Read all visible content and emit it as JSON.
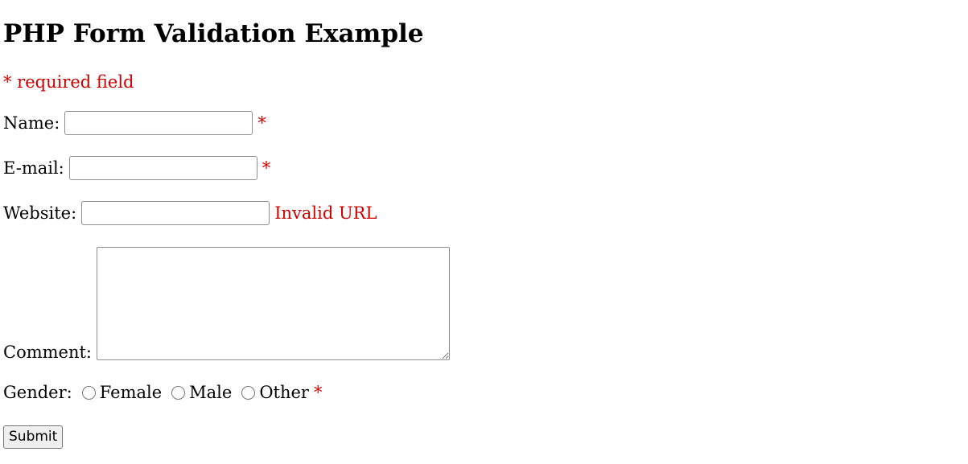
{
  "page": {
    "heading": "PHP Form Validation Example",
    "required_note": "* required field"
  },
  "form": {
    "name": {
      "label": "Name:",
      "value": "",
      "marker": "*"
    },
    "email": {
      "label": "E-mail:",
      "value": "",
      "marker": "*"
    },
    "website": {
      "label": "Website:",
      "value": "",
      "error": "Invalid URL"
    },
    "comment": {
      "label": "Comment:",
      "value": ""
    },
    "gender": {
      "label": "Gender:",
      "options": [
        "Female",
        "Male",
        "Other"
      ],
      "selected": null,
      "marker": "*"
    },
    "submit_label": "Submit"
  },
  "colors": {
    "error": "#d00000",
    "text": "#000000",
    "background": "#ffffff"
  }
}
